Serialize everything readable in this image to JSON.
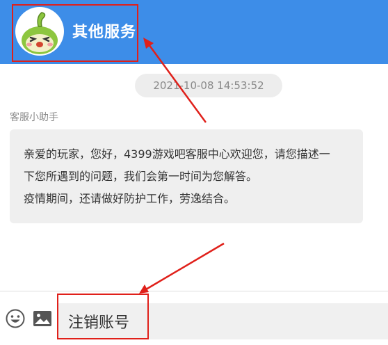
{
  "header": {
    "title": "其他服务",
    "background": "#3d8de8"
  },
  "chat": {
    "timestamp": "2021-10-08 14:53:52",
    "sender": "客服小助手",
    "message_lines": [
      "亲爱的玩家，您好，4399游戏吧客服中心欢迎您，请您描述一",
      "下您所遇到的问题，我们会第一时间为您解答。",
      "疫情期间，还请做好防护工作，劳逸结合。"
    ]
  },
  "composer": {
    "emoji_icon": "smile-icon",
    "image_icon": "image-icon",
    "input_value": "注销账号"
  },
  "annotation_color": "#e0201a"
}
